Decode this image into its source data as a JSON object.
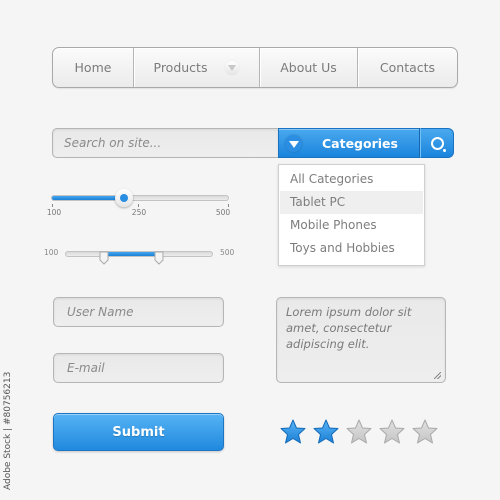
{
  "nav": {
    "items": [
      {
        "label": "Home"
      },
      {
        "label": "Products",
        "has_dropdown": true
      },
      {
        "label": "About Us"
      },
      {
        "label": "Contacts"
      }
    ]
  },
  "search": {
    "placeholder": "Search on site...",
    "categories_label": "Categories",
    "search_icon": "search-icon",
    "dropdown": {
      "items": [
        "All Categories",
        "Tablet PC",
        "Mobile Phones",
        "Toys and Hobbies"
      ],
      "highlighted_index": 1
    }
  },
  "slider_single": {
    "min": 100,
    "max": 500,
    "value": 250,
    "tick_labels": [
      "100",
      "250",
      "500"
    ]
  },
  "slider_range": {
    "min": 100,
    "max": 500,
    "min_label": "100",
    "max_label": "500",
    "low_fraction": 0.26,
    "high_fraction": 0.63
  },
  "form": {
    "username_placeholder": "User Name",
    "email_placeholder": "E-mail",
    "textarea_text": "Lorem ipsum dolor sit amet, consectetur adipiscing elit.",
    "submit_label": "Submit"
  },
  "rating": {
    "value": 2,
    "max": 5,
    "active_color": "#2a8ee2",
    "inactive_color": "#cfcfcf"
  },
  "colors": {
    "accent": "#2a8ee2",
    "background": "#f5f5f5"
  },
  "watermark": "Adobe Stock | #80756213"
}
